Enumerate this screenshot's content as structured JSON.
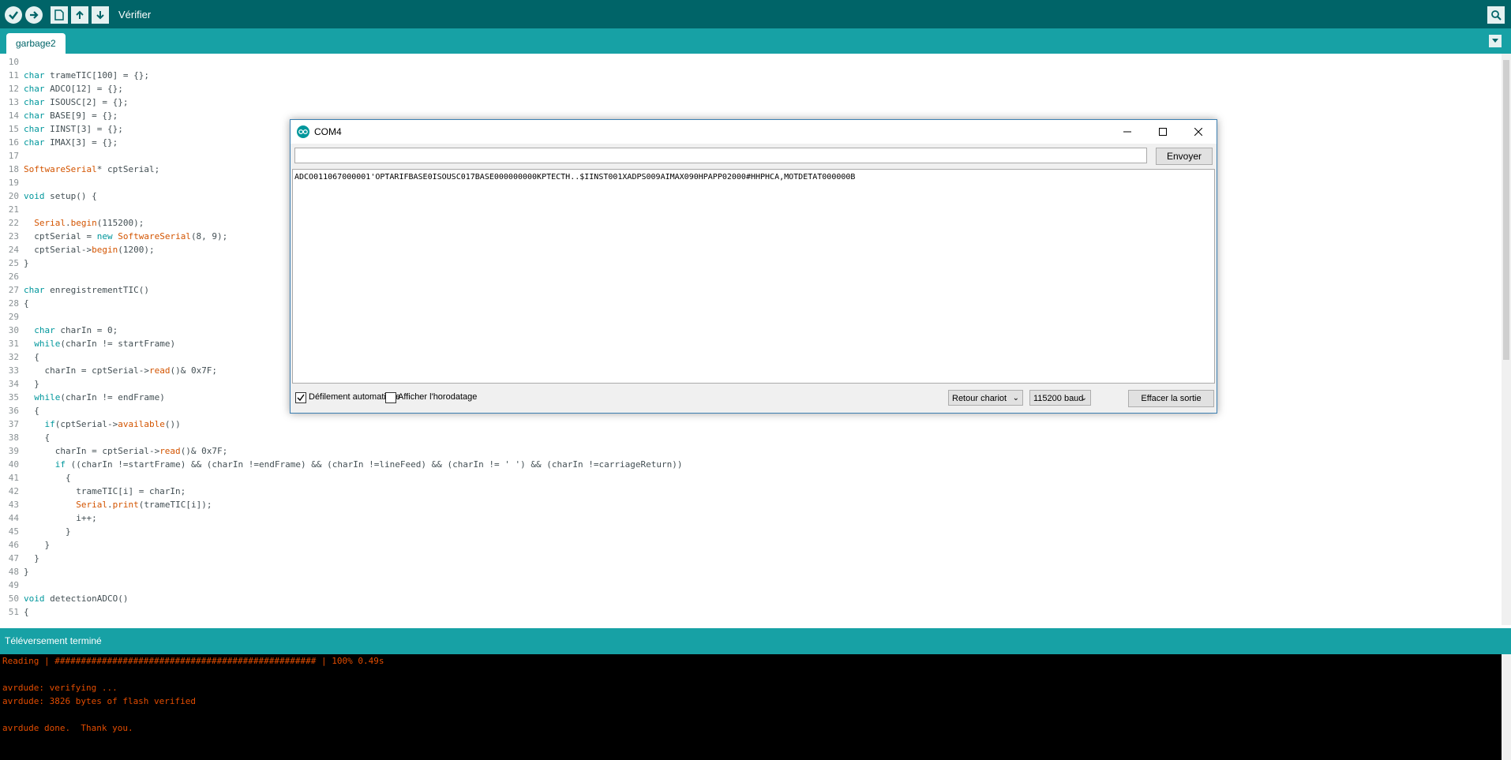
{
  "toolbar": {
    "verify_label": "Vérifier",
    "icons": [
      "check-icon",
      "arrow-right-icon",
      "new-file-icon",
      "open-icon",
      "save-icon",
      "serial-monitor-icon"
    ]
  },
  "tabs": [
    {
      "label": "garbage2"
    }
  ],
  "editor": {
    "lines": [
      {
        "n": "10",
        "t": ""
      },
      {
        "n": "11",
        "t": "char trameTIC[100] = {};"
      },
      {
        "n": "12",
        "t": "char ADCO[12] = {};"
      },
      {
        "n": "13",
        "t": "char ISOUSC[2] = {};"
      },
      {
        "n": "14",
        "t": "char BASE[9] = {};"
      },
      {
        "n": "15",
        "t": "char IINST[3] = {};"
      },
      {
        "n": "16",
        "t": "char IMAX[3] = {};"
      },
      {
        "n": "17",
        "t": ""
      },
      {
        "n": "18",
        "t": "SoftwareSerial* cptSerial;"
      },
      {
        "n": "19",
        "t": ""
      },
      {
        "n": "20",
        "t": "void setup() {"
      },
      {
        "n": "21",
        "t": ""
      },
      {
        "n": "22",
        "t": "  Serial.begin(115200);"
      },
      {
        "n": "23",
        "t": "  cptSerial = new SoftwareSerial(8, 9);"
      },
      {
        "n": "24",
        "t": "  cptSerial->begin(1200);"
      },
      {
        "n": "25",
        "t": "}"
      },
      {
        "n": "26",
        "t": ""
      },
      {
        "n": "27",
        "t": "char enregistrementTIC()"
      },
      {
        "n": "28",
        "t": "{"
      },
      {
        "n": "29",
        "t": ""
      },
      {
        "n": "30",
        "t": "  char charIn = 0;"
      },
      {
        "n": "31",
        "t": "  while(charIn != startFrame)"
      },
      {
        "n": "32",
        "t": "  {"
      },
      {
        "n": "33",
        "t": "    charIn = cptSerial->read()& 0x7F;"
      },
      {
        "n": "34",
        "t": "  }"
      },
      {
        "n": "35",
        "t": "  while(charIn != endFrame)"
      },
      {
        "n": "36",
        "t": "  {"
      },
      {
        "n": "37",
        "t": "    if(cptSerial->available())"
      },
      {
        "n": "38",
        "t": "    {"
      },
      {
        "n": "39",
        "t": "      charIn = cptSerial->read()& 0x7F;"
      },
      {
        "n": "40",
        "t": "      if ((charIn !=startFrame) && (charIn !=endFrame) && (charIn !=lineFeed) && (charIn != ' ') && (charIn !=carriageReturn))"
      },
      {
        "n": "41",
        "t": "        {"
      },
      {
        "n": "42",
        "t": "          trameTIC[i] = charIn;"
      },
      {
        "n": "43",
        "t": "          Serial.print(trameTIC[i]);"
      },
      {
        "n": "44",
        "t": "          i++;"
      },
      {
        "n": "45",
        "t": "        }"
      },
      {
        "n": "46",
        "t": "    }"
      },
      {
        "n": "47",
        "t": "  }"
      },
      {
        "n": "48",
        "t": "}"
      },
      {
        "n": "49",
        "t": ""
      },
      {
        "n": "50",
        "t": "void detectionADCO()"
      },
      {
        "n": "51",
        "t": "{"
      }
    ]
  },
  "status": {
    "text": "Téléversement terminé"
  },
  "console": {
    "lines": [
      "Reading | ################################################## | 100% 0.49s",
      "",
      "avrdude: verifying ...",
      "avrdude: 3826 bytes of flash verified",
      "",
      "avrdude done.  Thank you."
    ]
  },
  "serial_monitor": {
    "title": "COM4",
    "input_value": "",
    "send_label": "Envoyer",
    "output": "ADCO011067000001'OPTARIFBASE0ISOUSC017BASE000000000KPTECTH..$IINST001XADPS009AIMAX090HPAPP02000#HHPHCA,MOTDETAT000000B",
    "autoscroll_label": "Défilement automatique",
    "autoscroll_checked": true,
    "timestamp_label": "Afficher l'horodatage",
    "timestamp_checked": false,
    "line_ending": "Retour chariot",
    "baud": "115200 baud",
    "clear_label": "Effacer la sortie"
  },
  "colors": {
    "toolbar": "#006468",
    "tabbar": "#17a1a5",
    "keyword": "#00979c",
    "function": "#d35400",
    "console_text": "#e34c00"
  }
}
